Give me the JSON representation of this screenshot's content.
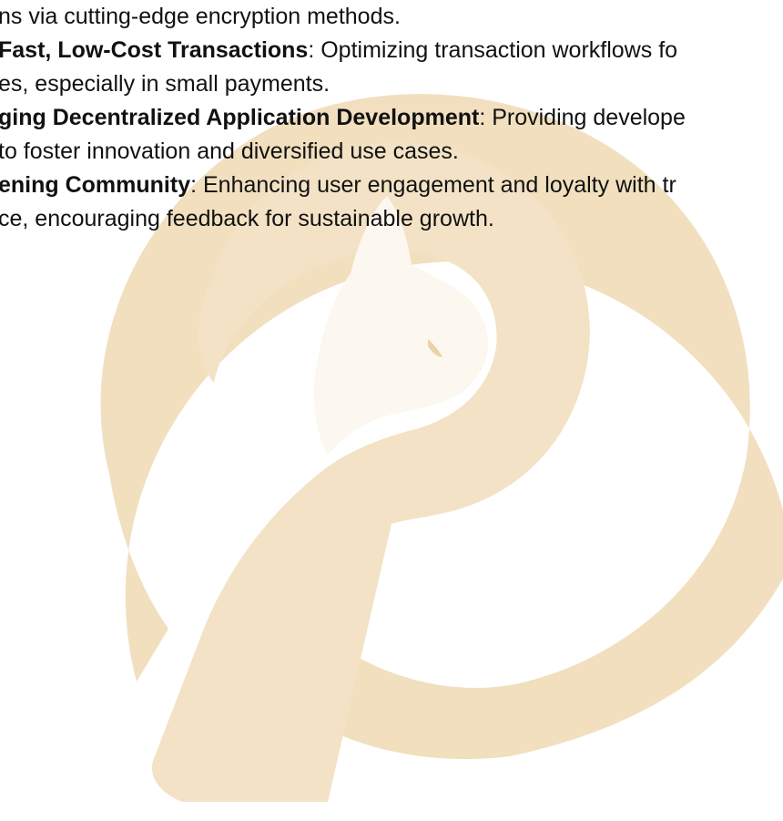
{
  "document": {
    "lines": [
      {
        "plain_before": "ns via cutting-edge encryption methods.",
        "bold": "",
        "plain_after": ""
      },
      {
        "plain_before": "",
        "bold": "Fast, Low-Cost Transactions",
        "plain_after": ": Optimizing transaction workflows fo"
      },
      {
        "plain_before": "es, especially in small payments.",
        "bold": "",
        "plain_after": ""
      },
      {
        "plain_before": "",
        "bold": "ging Decentralized Application Development",
        "plain_after": ": Providing develope"
      },
      {
        "plain_before": " to foster innovation and diversified use cases.",
        "bold": "",
        "plain_after": ""
      },
      {
        "plain_before": "",
        "bold": "ening Community",
        "plain_after": ": Enhancing user engagement and loyalty with tr"
      },
      {
        "plain_before": "ce, encouraging feedback for sustainable growth.",
        "bold": "",
        "plain_after": ""
      }
    ]
  },
  "watermark": {
    "icon": "cat-p-logo-watermark",
    "colors": {
      "ring": "#e9cc9c",
      "shape": "#eed6ac",
      "cat_highlight": "#fbf5ea",
      "background": "#ffffff"
    }
  }
}
